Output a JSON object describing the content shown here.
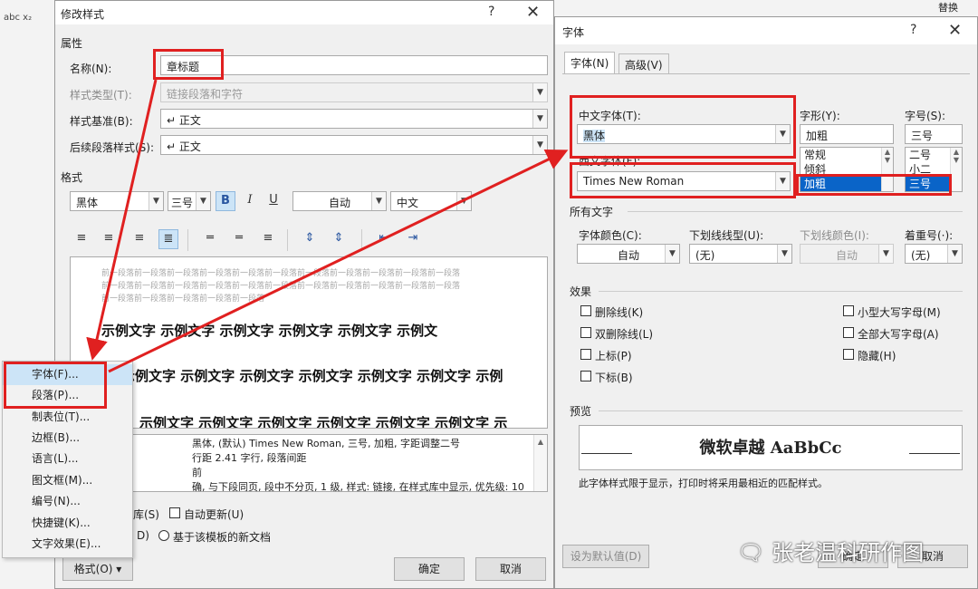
{
  "background": {
    "left_toolbar": "abc x₂",
    "top_right": "替换"
  },
  "modify_style": {
    "title": "修改样式",
    "help": "?",
    "close": "✕",
    "section_properties": "属性",
    "name_label": "名称(N):",
    "name_value": "章标题",
    "style_type_label": "样式类型(T):",
    "style_type_value": "链接段落和字符",
    "based_on_label": "样式基准(B):",
    "based_on_value": "↵ 正文",
    "next_para_label": "后续段落样式(S):",
    "next_para_value": "↵ 正文",
    "section_format": "格式",
    "font_value": "黑体",
    "size_value": "三号",
    "bold": "B",
    "italic": "I",
    "underline": "U",
    "color_value": "自动",
    "lang_value": "中文",
    "preview_prev_1": "前一段落前一段落前一段落前一段落前一段落前一段落前一段落前一段落前一段落前一段落前一段落",
    "preview_prev_2": "前一段落前一段落前一段落前一段落前一段落前一段落前一段落前一段落前一段落前一段落前一段落",
    "preview_prev_3": "前一段落前一段落前一段落前一段落前一段落",
    "sample_1": "示例文字 示例文字 示例文字 示例文字 示例文字 示例文",
    "sample_2": "示例文字 示例文字 示例文字 示例文字 示例文字 示例文字 示例",
    "sample_3": "示例文字 示例文字 示例文字 示例文字 示例文字 示例文字 示",
    "desc_1": "黑体, (默认) Times New Roman, 三号, 加粗, 字距调整二号",
    "desc_2": "行距 2.41 字行, 段落间距",
    "desc_3": "前",
    "desc_4": "确, 与下段同页, 段中不分页, 1 级, 样式: 链接, 在样式库中显示, 优先级: 10",
    "add_gallery": "库(S)",
    "auto_update": "自动更新(U)",
    "only_doc": "D)",
    "new_docs": "基于该模板的新文档",
    "format_btn": "格式(O) ▾",
    "ok": "确定",
    "cancel": "取消"
  },
  "format_menu": [
    "字体(F)...",
    "段落(P)...",
    "制表位(T)...",
    "边框(B)...",
    "语言(L)...",
    "图文框(M)...",
    "编号(N)...",
    "快捷键(K)...",
    "文字效果(E)..."
  ],
  "font_dialog": {
    "title": "字体",
    "help": "?",
    "close": "✕",
    "tab_font": "字体(N)",
    "tab_advanced": "高级(V)",
    "cn_font_label": "中文字体(T):",
    "cn_font_value": "黑体",
    "west_font_label": "西文字体(F):",
    "west_font_value": "Times New Roman",
    "style_label": "字形(Y):",
    "style_value": "加粗",
    "style_list": [
      "常规",
      "倾斜",
      "加粗"
    ],
    "size_label": "字号(S):",
    "size_value": "三号",
    "size_list": [
      "二号",
      "小二",
      "三号"
    ],
    "all_text": "所有文字",
    "color_label": "字体颜色(C):",
    "color_value": "自动",
    "ul_style_label": "下划线线型(U):",
    "ul_style_value": "(无)",
    "ul_color_label": "下划线颜色(I):",
    "ul_color_value": "自动",
    "emph_label": "着重号(·):",
    "emph_value": "(无)",
    "effects": "效果",
    "strike": "删除线(K)",
    "dstrike": "双删除线(L)",
    "sup": "上标(P)",
    "sub": "下标(B)",
    "smallcaps": "小型大写字母(M)",
    "allcaps": "全部大写字母(A)",
    "hidden": "隐藏(H)",
    "preview_label": "预览",
    "preview_text": "微软卓越 AaBbCc",
    "preview_note": "此字体样式限于显示，打印时将采用最相近的匹配样式。",
    "set_default": "设为默认值(D)",
    "ok": "确定",
    "cancel": "取消"
  },
  "watermark": "张老温科研作图",
  "colors": {
    "highlight": "#e02020",
    "selection": "#cce4f7"
  }
}
